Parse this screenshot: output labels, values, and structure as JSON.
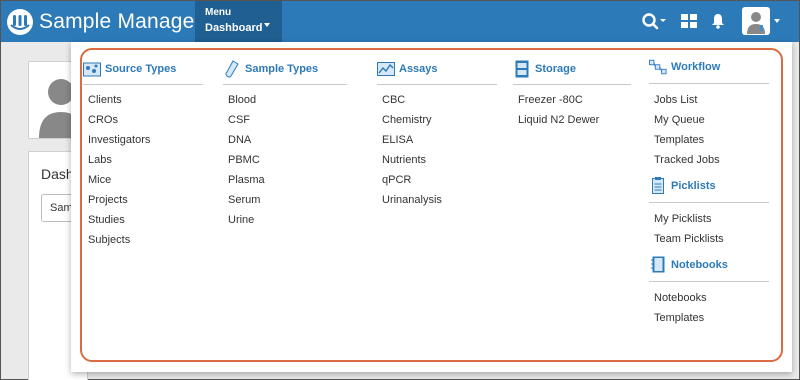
{
  "app": {
    "name": "Sample Manager"
  },
  "menu": {
    "top_label": "Menu",
    "current_label": "Dashboard"
  },
  "nav_icons": [
    "search-icon",
    "grid-icon",
    "bell-icon",
    "user-avatar-icon"
  ],
  "background": {
    "title_partial": "Dash",
    "button_partial": "Sam"
  },
  "columns": [
    {
      "header": "Source Types",
      "icon": "source-types-icon",
      "items": [
        "Clients",
        "CROs",
        "Investigators",
        "Labs",
        "Mice",
        "Projects",
        "Studies",
        "Subjects"
      ]
    },
    {
      "header": "Sample Types",
      "icon": "test-tube-icon",
      "items": [
        "Blood",
        "CSF",
        "DNA",
        "PBMC",
        "Plasma",
        "Serum",
        "Urine"
      ]
    },
    {
      "header": "Assays",
      "icon": "chart-icon",
      "items": [
        "CBC",
        "Chemistry",
        "ELISA",
        "Nutrients",
        "qPCR",
        "Urinanalysis"
      ]
    },
    {
      "header": "Storage",
      "icon": "storage-icon",
      "items": [
        "Freezer -80C",
        "Liquid N2 Dewer"
      ]
    }
  ],
  "workflow": {
    "header": "Workflow",
    "icon": "workflow-icon",
    "items": [
      "Jobs List",
      "My Queue",
      "Templates",
      "Tracked Jobs"
    ]
  },
  "picklists": {
    "header": "Picklists",
    "icon": "clipboard-icon",
    "items": [
      "My Picklists",
      "Team Picklists"
    ]
  },
  "notebooks": {
    "header": "Notebooks",
    "icon": "notebook-icon",
    "items": [
      "Notebooks",
      "Templates"
    ]
  },
  "colors": {
    "navbar": "#2d7ab9",
    "menu_active": "#1f5f91",
    "accent": "#2d7ab9",
    "highlight_ring": "#d96c40"
  }
}
